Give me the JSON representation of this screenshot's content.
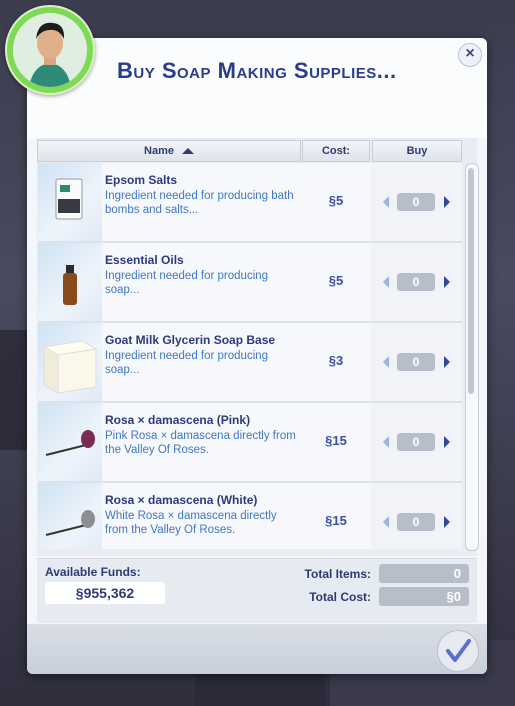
{
  "dialog": {
    "title": "Buy Soap Making Supplies...",
    "close_label": "×"
  },
  "columns": {
    "name": "Name",
    "cost": "Cost:",
    "buy": "Buy"
  },
  "items": [
    {
      "name": "Epsom Salts",
      "desc": "Ingredient needed for producing bath bombs and salts...",
      "cost": "§5",
      "qty": "0"
    },
    {
      "name": "Essential Oils",
      "desc": "Ingredient needed for producing soap...",
      "cost": "§5",
      "qty": "0"
    },
    {
      "name": "Goat Milk Glycerin Soap Base",
      "desc": "Ingredient needed for producing soap...",
      "cost": "§3",
      "qty": "0"
    },
    {
      "name": "Rosa × damascena (Pink)",
      "desc": "Pink Rosa × damascena directly from the Valley Of Roses.",
      "cost": "§15",
      "qty": "0"
    },
    {
      "name": "Rosa × damascena (White)",
      "desc": "White Rosa × damascena directly from the Valley Of Roses.",
      "cost": "§15",
      "qty": "0"
    }
  ],
  "footer": {
    "funds_label": "Available Funds:",
    "funds_value": "§955,362",
    "total_items_label": "Total Items:",
    "total_items_value": "0",
    "total_cost_label": "Total Cost:",
    "total_cost_value": "§0"
  },
  "colors": {
    "accent": "#2a3c8a",
    "link": "#3f78c4",
    "avatar_ring": "#7ed957"
  }
}
